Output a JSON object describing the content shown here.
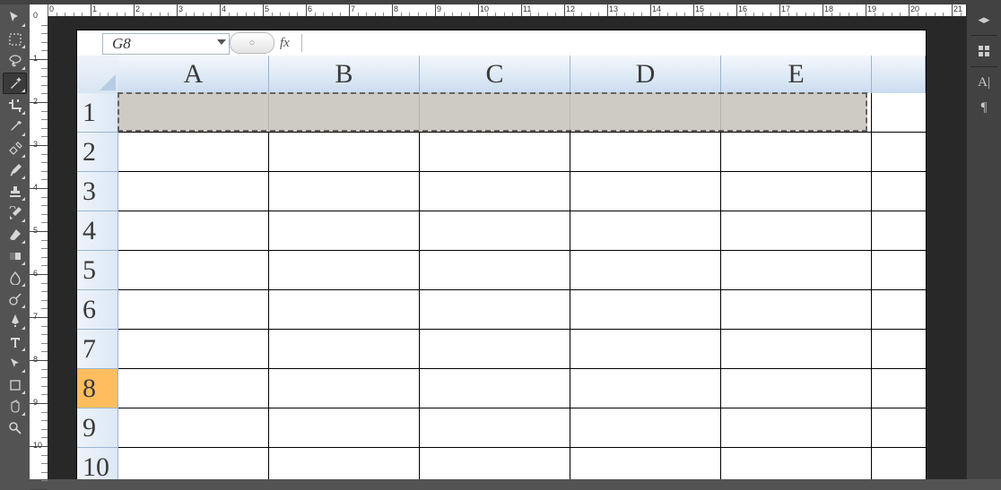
{
  "hruler_ticks": [
    "0",
    "1",
    "2",
    "3",
    "4",
    "5",
    "6",
    "7",
    "8",
    "9",
    "10",
    "11",
    "12",
    "13",
    "14",
    "15",
    "16",
    "17",
    "18",
    "19",
    "20",
    "21"
  ],
  "vruler_ticks": [
    "0",
    "1",
    "2",
    "3",
    "4",
    "5",
    "6",
    "7",
    "8",
    "9",
    "10"
  ],
  "spreadsheet": {
    "name_box": "G8",
    "fx_label": "fx",
    "columns": [
      "A",
      "B",
      "C",
      "D",
      "E"
    ],
    "rows": [
      "1",
      "2",
      "3",
      "4",
      "5",
      "6",
      "7",
      "8",
      "9",
      "10"
    ],
    "selected_row": "8"
  },
  "tools": [
    "move",
    "marquee",
    "lasso",
    "wand",
    "crop",
    "eyedropper",
    "heal",
    "brush",
    "stamp",
    "history",
    "eraser",
    "bucket",
    "blur",
    "dodge",
    "pen",
    "type",
    "path",
    "shape",
    "hand",
    "zoom"
  ]
}
